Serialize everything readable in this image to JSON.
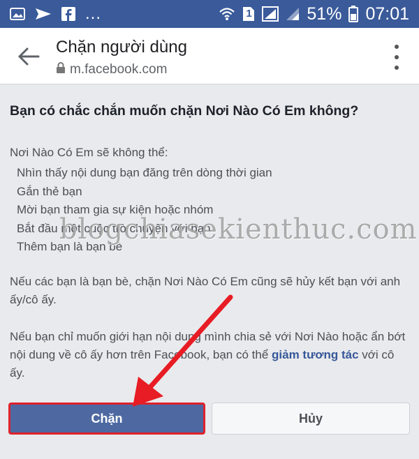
{
  "status_bar": {
    "overflow": "...",
    "battery": "51%",
    "time": "07:01",
    "sim_badge": "1",
    "icons": [
      "image-icon",
      "send-icon",
      "facebook-icon",
      "wifi-icon",
      "sim-icon",
      "signal-icon",
      "signal-weak-icon",
      "battery-icon"
    ]
  },
  "header": {
    "title": "Chặn người dùng",
    "url": "m.facebook.com"
  },
  "dialog": {
    "question": "Bạn có chắc chắn muốn chặn Nơi Nào Có Em không?",
    "lead": "Nơi Nào Có Em sẽ không thể:",
    "items": [
      "Nhìn thấy nội dung bạn đăng trên dòng thời gian",
      "Gắn thẻ bạn",
      "Mời bạn tham gia sự kiện hoặc nhóm",
      "Bắt đầu một cuộc trò chuyện với bạn",
      "Thêm bạn là bạn bè"
    ],
    "para1": "Nếu các bạn là bạn bè, chặn Nơi Nào Có Em cũng sẽ hủy kết bạn với anh ấy/cô ấy.",
    "para2_before": "Nếu bạn chỉ muốn giới hạn nội dung mình chia sẻ với Nơi Nào hoặc ẩn bớt nội dung về cô ấy hơn trên Facebook, bạn có thể ",
    "para2_link": "giảm tương tác",
    "para2_after": " với cô ấy."
  },
  "buttons": {
    "block": "Chặn",
    "cancel": "Hủy"
  },
  "watermark": "blogchiasekienthuc.com",
  "colors": {
    "status_bar": "#3a5a9a",
    "primary_button": "#4e69a2",
    "highlight": "#e0212b",
    "link": "#365899"
  }
}
